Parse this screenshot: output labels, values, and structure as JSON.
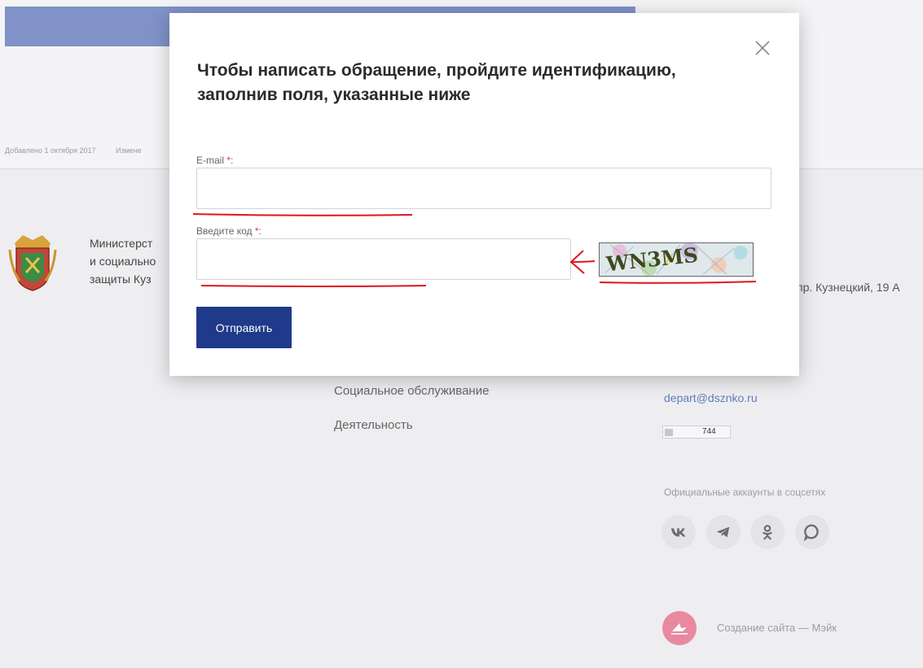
{
  "background": {
    "meta": {
      "added": "Добавлено 1 октября 2017",
      "changed": "Измене"
    },
    "ministry_lines": [
      "Министерст",
      "и социально",
      "защиты Куз"
    ],
    "address": "пр. Кузнецкий, 19 А",
    "menu": [
      "Социальное обслуживание",
      "Деятельность"
    ],
    "email": "depart@dsznko.ru",
    "counter_value": "744",
    "social_title": "Официальные аккаунты в соцсетях",
    "social_icons": [
      "vk-icon",
      "telegram-icon",
      "odnoklassniki-icon",
      "max-messenger-icon"
    ],
    "maker_text": "Создание сайта — Мэйк"
  },
  "modal": {
    "title": "Чтобы написать обращение, пройдите идентификацию, заполнив поля, указанные ниже",
    "email_label": "E-mail",
    "email_value": "",
    "code_label": "Введите код",
    "code_value": "",
    "required_mark": "*",
    "label_suffix": ":",
    "captcha_text": "WN3MS",
    "submit_label": "Отправить"
  },
  "colors": {
    "accent": "#1f3a8a",
    "required": "#e0303a",
    "annotation": "#e0141e",
    "hero": "#8092c8"
  }
}
